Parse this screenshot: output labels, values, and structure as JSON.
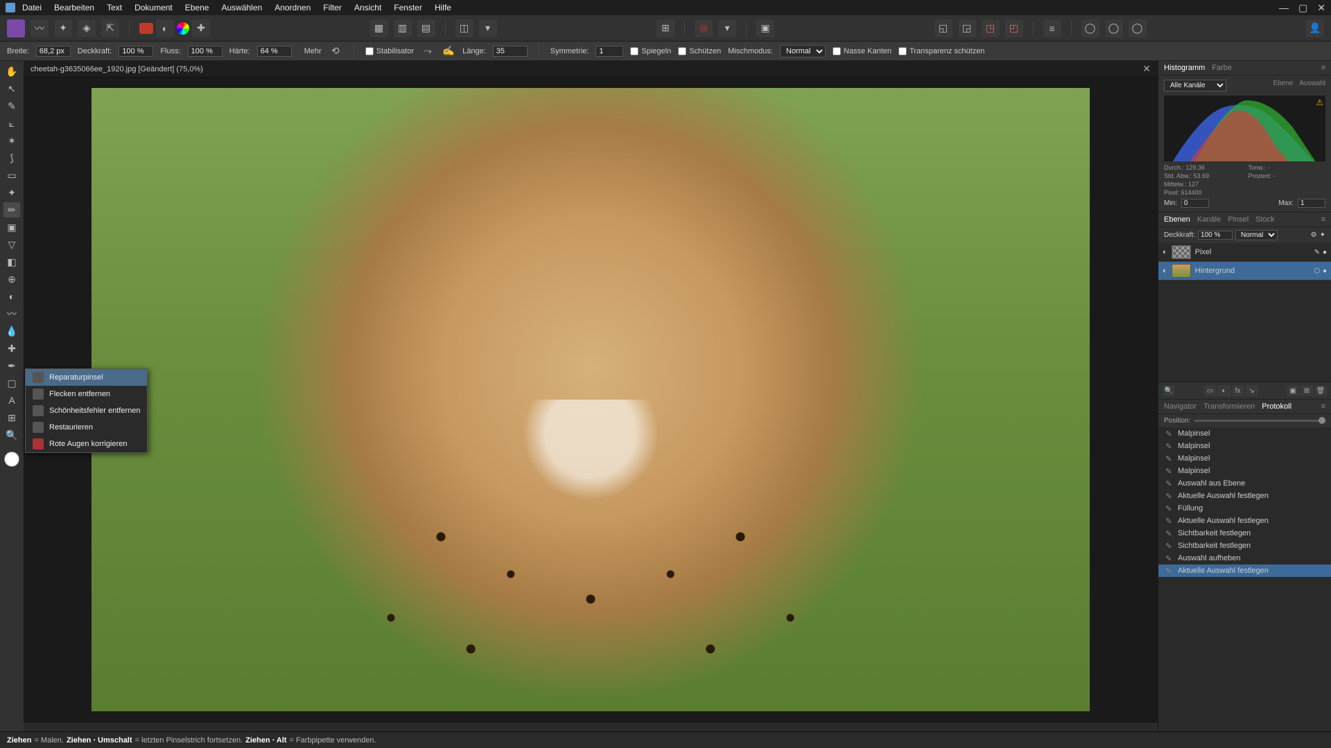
{
  "menu": [
    "Datei",
    "Bearbeiten",
    "Text",
    "Dokument",
    "Ebene",
    "Auswählen",
    "Anordnen",
    "Filter",
    "Ansicht",
    "Fenster",
    "Hilfe"
  ],
  "context": {
    "breite_label": "Breite:",
    "breite_value": "68,2 px",
    "deckkraft_label": "Deckkraft:",
    "deckkraft_value": "100 %",
    "fluss_label": "Fluss:",
    "fluss_value": "100 %",
    "haerte_label": "Härte:",
    "haerte_value": "64 %",
    "mehr": "Mehr",
    "stabilisator": "Stabilisator",
    "laenge_label": "Länge:",
    "laenge_value": "35",
    "symmetrie_label": "Symmetrie:",
    "symmetrie_value": "1",
    "spiegeln": "Spiegeln",
    "schuetzen": "Schützen",
    "mischmodus_label": "Mischmodus:",
    "mischmodus_value": "Normal",
    "nasse_kanten": "Nasse Kanten",
    "transparenz": "Transparenz schützen"
  },
  "doc_tab": "cheetah-g3635066ee_1920.jpg [Geändert] (75,0%)",
  "flyout": {
    "items": [
      "Reparaturpinsel",
      "Flecken entfernen",
      "Schönheitsfehler entfernen",
      "Restaurieren",
      "Rote Augen korrigieren"
    ]
  },
  "panels": {
    "histo_tabs": [
      "Histogramm",
      "Farbe"
    ],
    "histo_channel": "Alle Kanäle",
    "histo_link1": "Ebene",
    "histo_link2": "Auswahl",
    "histo_stats": {
      "durch": "Durch.: 129.36",
      "stdabw": "Std. Abw.: 53.69",
      "mittelw": "Mittelw.: 127",
      "pixel": "Pixel: 614400",
      "tonw": "Tonw.: -",
      "prozent": "Prozent: -"
    },
    "min_label": "Min:",
    "min_value": "0",
    "max_label": "Max:",
    "max_value": "1",
    "layer_tabs": [
      "Ebenen",
      "Kanäle",
      "Pinsel",
      "Stock"
    ],
    "layer_deckkraft_label": "Deckkraft:",
    "layer_deckkraft_value": "100 %",
    "layer_blend": "Normal",
    "layers": [
      {
        "name": "Pixel",
        "selected": false,
        "transparent": true
      },
      {
        "name": "Hintergrund",
        "selected": true,
        "transparent": false
      }
    ],
    "proto_tabs": [
      "Navigator",
      "Transformieren",
      "Protokoll"
    ],
    "proto_position": "Position:",
    "proto_items": [
      "Malpinsel",
      "Malpinsel",
      "Malpinsel",
      "Malpinsel",
      "Auswahl aus Ebene",
      "Aktuelle Auswahl festlegen",
      "Füllung",
      "Aktuelle Auswahl festlegen",
      "Sichtbarkeit festlegen",
      "Sichtbarkeit festlegen",
      "Auswahl aufheben",
      "Aktuelle Auswahl festlegen"
    ]
  },
  "status": {
    "s1a": "Ziehen",
    "s1b": " = Malen. ",
    "s2a": "Ziehen ⋅ Umschalt",
    "s2b": " = letzten Pinselstrich fortsetzen. ",
    "s3a": "Ziehen ⋅ Alt",
    "s3b": " = Farbpipette verwenden."
  }
}
